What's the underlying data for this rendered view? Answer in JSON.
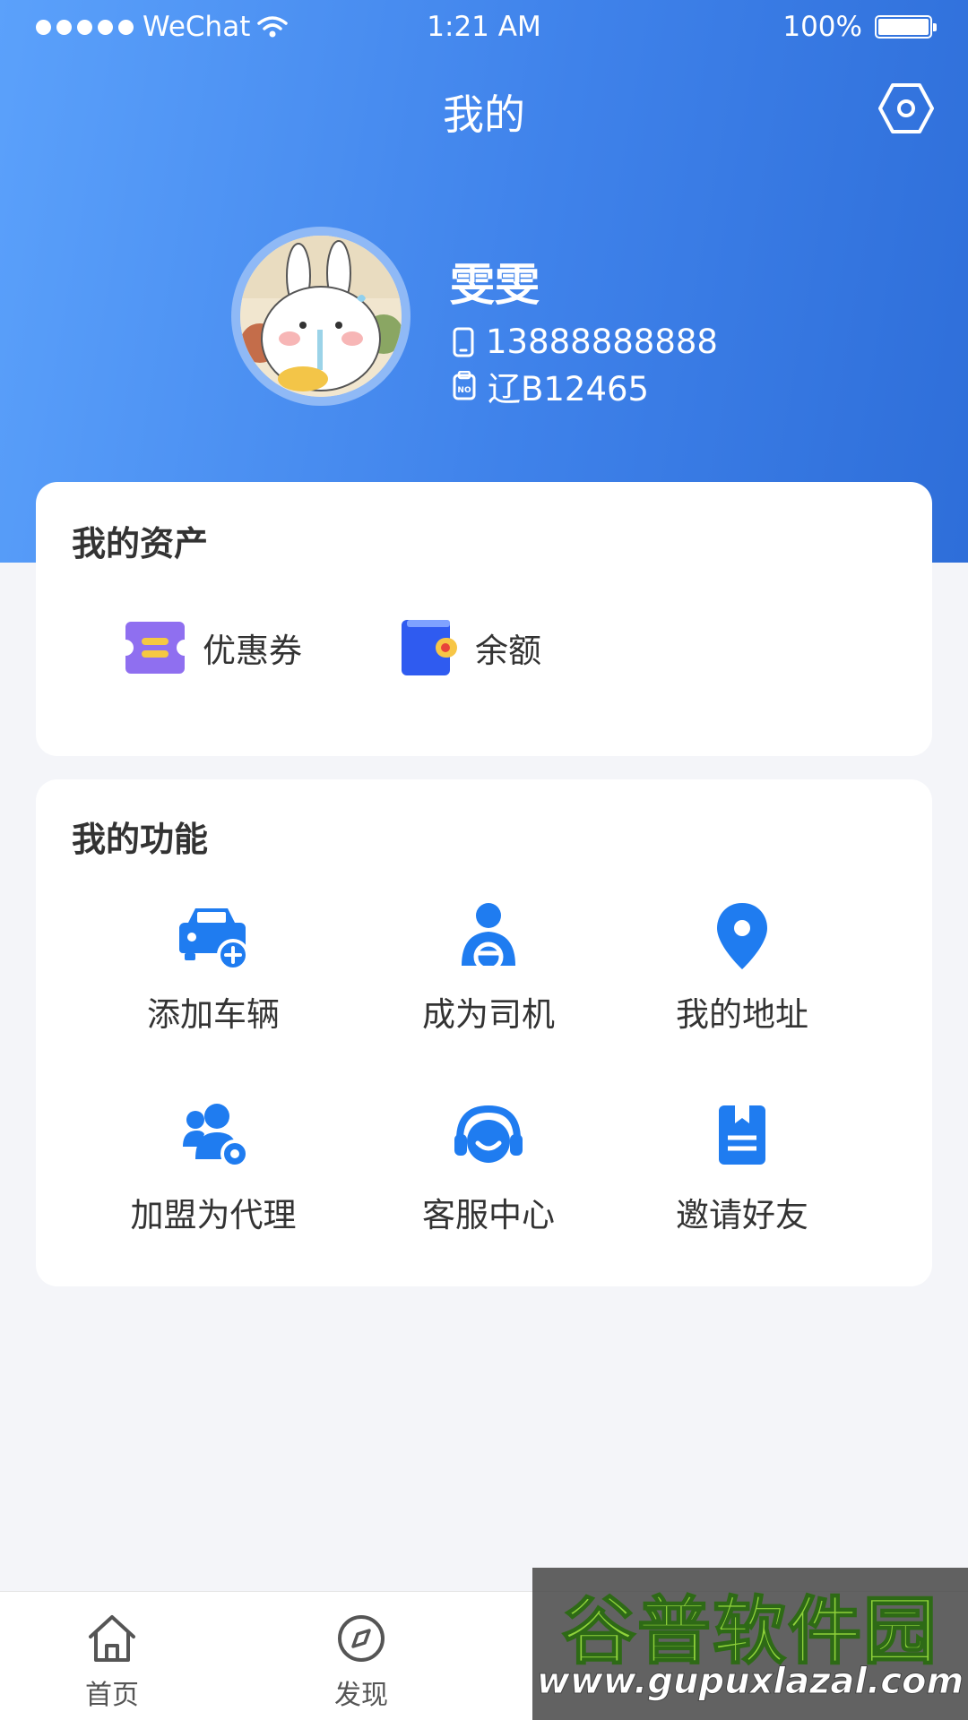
{
  "status_bar": {
    "carrier": "WeChat",
    "time": "1:21 AM",
    "battery": "100%"
  },
  "nav": {
    "title": "我的"
  },
  "profile": {
    "name": "雯雯",
    "phone": "13888888888",
    "plate": "辽B12465"
  },
  "assets": {
    "title": "我的资产",
    "items": [
      {
        "label": "优惠券",
        "icon": "coupon-icon"
      },
      {
        "label": "余额",
        "icon": "wallet-icon"
      }
    ]
  },
  "functions": {
    "title": "我的功能",
    "items": [
      {
        "label": "添加车辆",
        "icon": "add-car-icon"
      },
      {
        "label": "成为司机",
        "icon": "driver-icon"
      },
      {
        "label": "我的地址",
        "icon": "location-pin-icon"
      },
      {
        "label": "加盟为代理",
        "icon": "agent-join-icon"
      },
      {
        "label": "客服中心",
        "icon": "headset-icon"
      },
      {
        "label": "邀请好友",
        "icon": "invite-book-icon"
      }
    ]
  },
  "tabs": [
    {
      "label": "首页",
      "icon": "home-icon"
    },
    {
      "label": "发现",
      "icon": "compass-icon"
    }
  ],
  "watermark": {
    "title": "谷普软件园",
    "url": "www.gupuxlazal.com"
  },
  "colors": {
    "primary": "#3f82ea",
    "accent_blue": "#1f7cf0",
    "coupon_purple": "#8f6ff0",
    "wallet_blue": "#2f5bf0"
  }
}
